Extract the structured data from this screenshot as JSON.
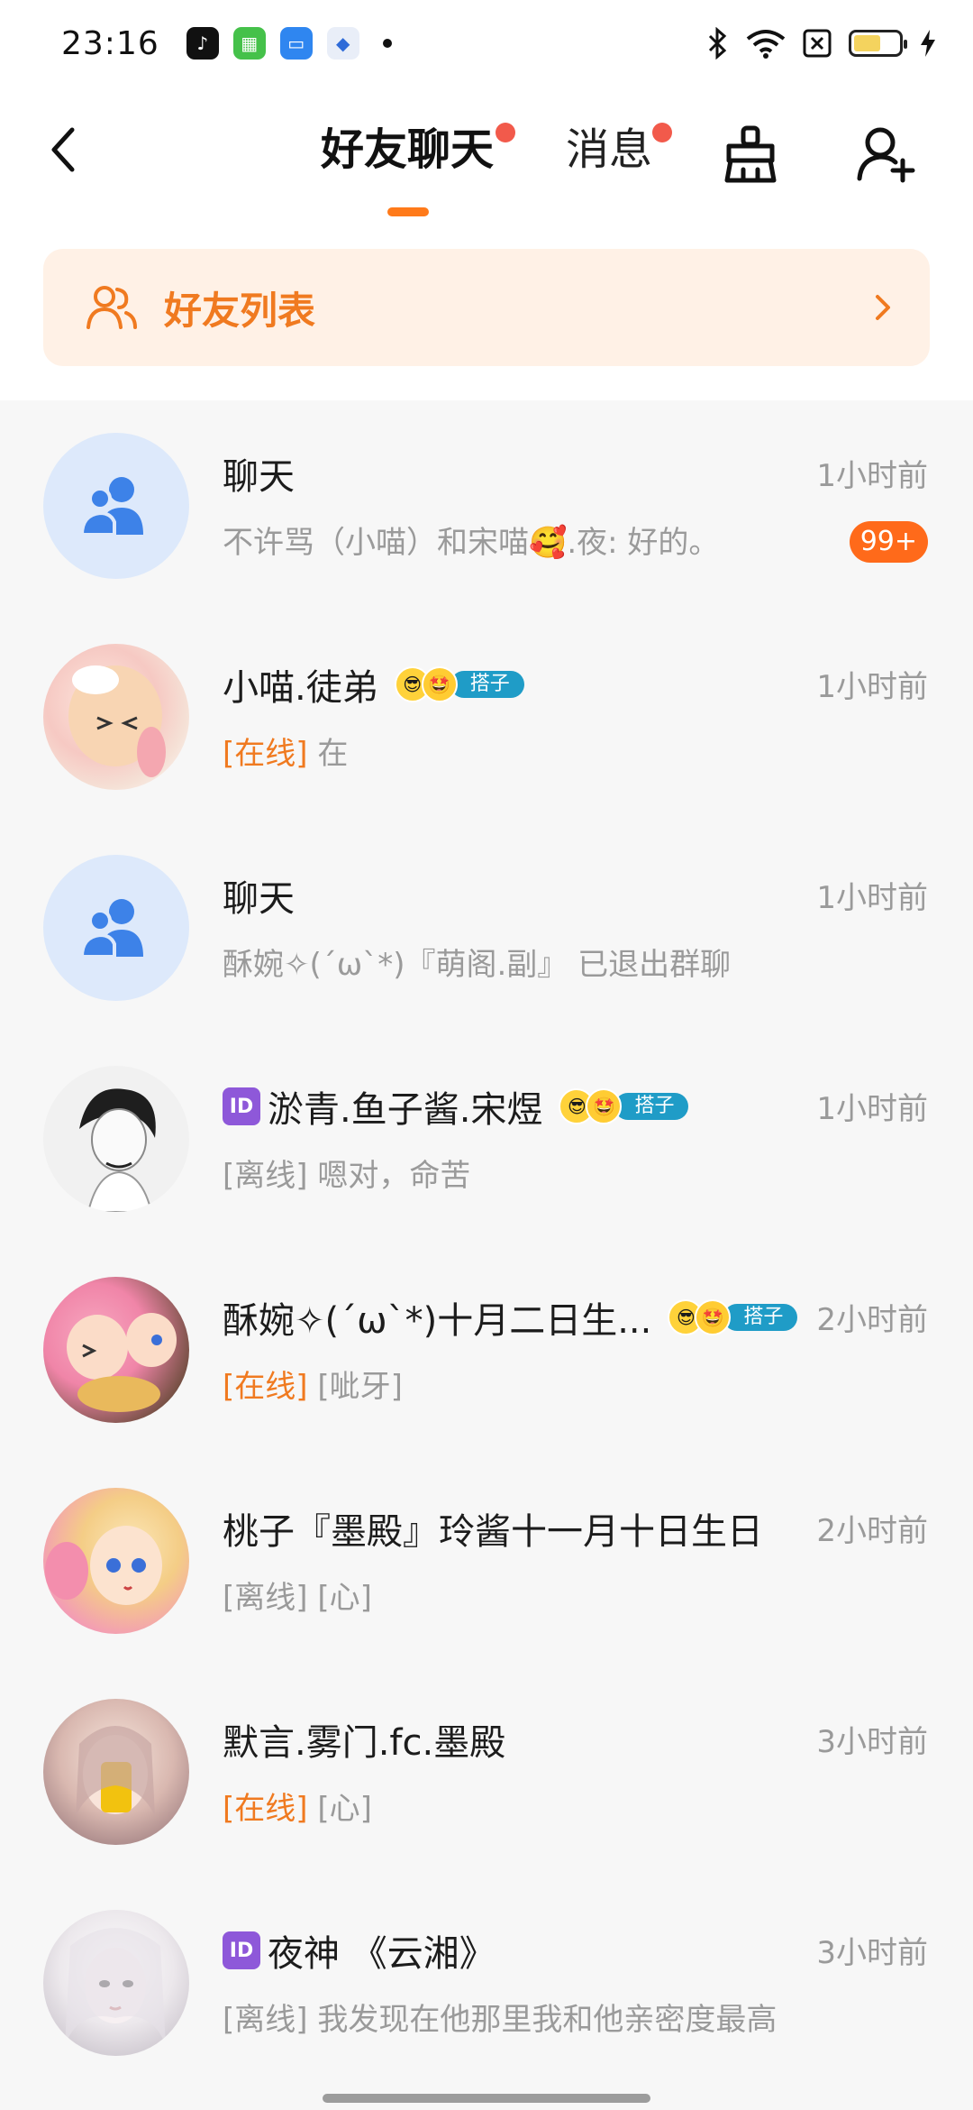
{
  "status_bar": {
    "time": "23:16",
    "apps": [
      "tiktok-icon",
      "green-app-icon",
      "blue-app-icon",
      "blue-compass-icon"
    ],
    "indicators": [
      "bluetooth-icon",
      "wifi-icon",
      "sim-off-icon",
      "battery-icon",
      "charging-icon"
    ]
  },
  "header": {
    "tabs": [
      {
        "label": "好友聊天",
        "active": true,
        "has_dot": true
      },
      {
        "label": "消息",
        "active": false,
        "has_dot": true
      }
    ],
    "icons": [
      "back-icon",
      "broom-icon",
      "add-friend-icon"
    ],
    "accent": "#ff7a1a"
  },
  "banner": {
    "label": "好友列表",
    "icon": "friends-icon",
    "color": "#f07a20"
  },
  "chats": [
    {
      "name": "聊天",
      "preview_status": "",
      "preview": "不许骂（小喵）和宋喵🥰.夜: 好的。",
      "time": "1小时前",
      "badge": "99+",
      "avatar": "group"
    },
    {
      "name": "小喵.徒弟",
      "tag": "搭子",
      "preview_status": "[在线]",
      "preview": " 在",
      "time": "1小时前",
      "badge": "",
      "avatar": "anime-1"
    },
    {
      "name": "聊天",
      "preview_status": "",
      "preview": "酥婉✧(´ω`*)『萌阁.副』 已退出群聊",
      "time": "1小时前",
      "badge": "",
      "avatar": "group"
    },
    {
      "name": "淤青.鱼子酱.宋煜",
      "id_badge": "ID",
      "tag": "搭子",
      "preview_status": "[离线]",
      "preview": " 嗯对，命苦",
      "time": "1小时前",
      "badge": "",
      "avatar": "sketch"
    },
    {
      "name": "酥婉✧(´ω`*)十月二日生...",
      "tag": "搭子",
      "preview_status": "[在线]",
      "preview": " [呲牙]",
      "time": "2小时前",
      "badge": "",
      "avatar": "anime-2"
    },
    {
      "name": "桃子『墨殿』玲酱十一月十日生日",
      "preview_status": "[离线]",
      "preview": " [心]",
      "time": "2小时前",
      "badge": "",
      "avatar": "anime-3"
    },
    {
      "name": "默言.雾门.fc.墨殿",
      "preview_status": "[在线]",
      "preview": " [心]",
      "time": "3小时前",
      "badge": "",
      "avatar": "doll-1"
    },
    {
      "name": "夜神 《云湘》",
      "id_badge": "ID",
      "preview_status": "[离线]",
      "preview": " 我发现在他那里我和他亲密度最高",
      "time": "3小时前",
      "badge": "",
      "avatar": "doll-2"
    }
  ]
}
